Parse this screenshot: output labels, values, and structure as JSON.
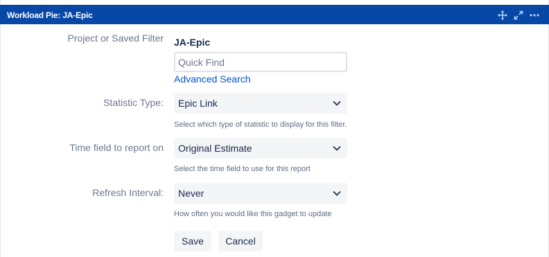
{
  "gadget": {
    "title": "Workload Pie: JA-Epic",
    "icons": [
      "move-icon",
      "expand-icon",
      "more-icon"
    ]
  },
  "form": {
    "project_label": "Project or Saved Filter",
    "project_value": "JA-Epic",
    "quick_find_placeholder": "Quick Find",
    "advanced_search": "Advanced Search",
    "statistic_label": "Statistic Type:",
    "statistic_value": "Epic Link",
    "statistic_help": "Select which type of statistic to display for this filter.",
    "time_field_label": "Time field to report on",
    "time_field_value": "Original Estimate",
    "time_field_help": "Select the time field to use for this report",
    "refresh_label": "Refresh Interval:",
    "refresh_value": "Never",
    "refresh_help": "How often you would like this gadget to update",
    "save": "Save",
    "cancel": "Cancel"
  },
  "colors": {
    "header_bg": "#0747a6",
    "link": "#0052cc",
    "select_bg": "#f4f5f7",
    "label": "#6b778c"
  }
}
